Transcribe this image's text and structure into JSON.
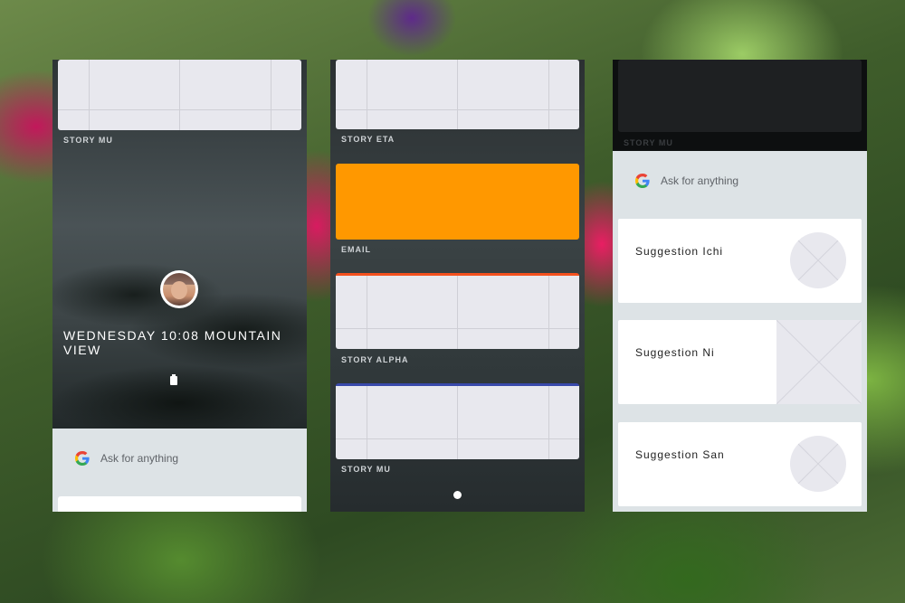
{
  "panel1": {
    "story_label": "STORY MU",
    "datetime": "WEDNESDAY 10:08 MOUNTAIN VIEW",
    "search_placeholder": "Ask for anything"
  },
  "panel2": {
    "cards": [
      {
        "label": "STORY ETA"
      },
      {
        "label": "EMAIL"
      },
      {
        "label": "STORY ALPHA"
      },
      {
        "label": "STORY MU"
      }
    ],
    "accent_colors": {
      "email": "#ff9800",
      "alpha": "#f4511e",
      "mu": "#3949ab"
    }
  },
  "panel3": {
    "story_label": "STORY MU",
    "search_placeholder": "Ask for anything",
    "suggestions": [
      {
        "title": "Suggestion Ichi",
        "image": "circle"
      },
      {
        "title": "Suggestion Ni",
        "image": "square"
      },
      {
        "title": "Suggestion San",
        "image": "circle"
      }
    ]
  }
}
